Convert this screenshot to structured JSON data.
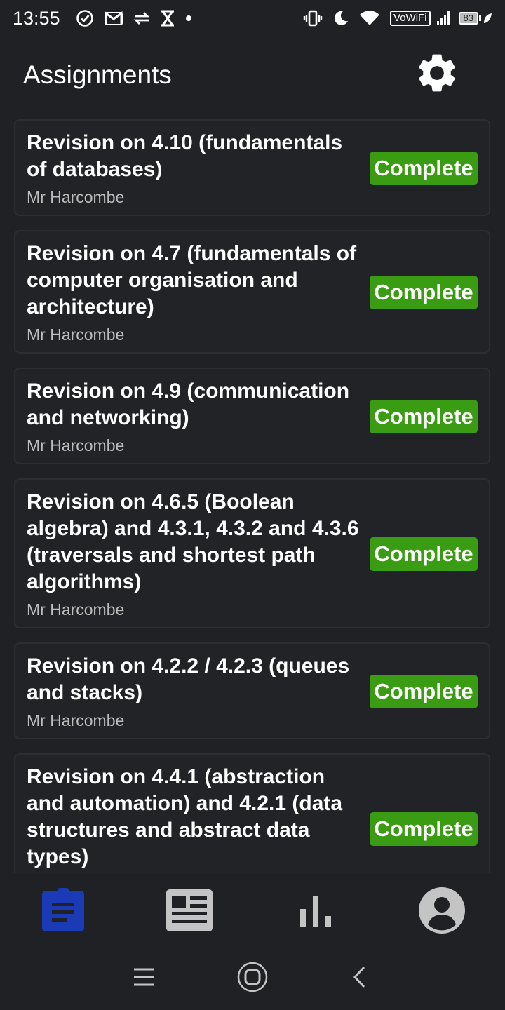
{
  "status_bar": {
    "time": "13:55",
    "left_icons": [
      "check-circle-icon",
      "gmail-icon",
      "data-transfer-icon",
      "hourglass-icon",
      "dot-icon"
    ],
    "vowifi_label": "VoWiFi",
    "battery_level": "83"
  },
  "header": {
    "title": "Assignments",
    "settings_icon": "gear-icon"
  },
  "assignments": [
    {
      "title": "Revision on 4.10 (fundamentals of databases)",
      "teacher": "Mr Harcombe",
      "status": "Complete"
    },
    {
      "title": "Revision on 4.7 (fundamentals of computer organisation and architecture)",
      "teacher": "Mr Harcombe",
      "status": "Complete"
    },
    {
      "title": "Revision on 4.9 (communication and networking)",
      "teacher": "Mr Harcombe",
      "status": "Complete"
    },
    {
      "title": "Revision on 4.6.5 (Boolean algebra) and 4.3.1, 4.3.2 and 4.3.6 (traversals and shortest path algorithms)",
      "teacher": "Mr Harcombe",
      "status": "Complete"
    },
    {
      "title": "Revision on 4.2.2 / 4.2.3 (queues and stacks)",
      "teacher": "Mr Harcombe",
      "status": "Complete"
    },
    {
      "title": "Revision on 4.4.1 (abstraction and automation) and 4.2.1 (data structures and abstract data types)",
      "teacher": "",
      "status": "Complete"
    }
  ],
  "bottom_nav": [
    {
      "icon": "assignment-icon",
      "active": true
    },
    {
      "icon": "newspaper-icon",
      "active": false
    },
    {
      "icon": "bar-chart-icon",
      "active": false
    },
    {
      "icon": "account-icon",
      "active": false
    }
  ],
  "colors": {
    "background": "#202125",
    "badge_green": "#3a9c12",
    "active_nav": "#1a3bb5",
    "inactive_nav": "#c4c4c4"
  }
}
